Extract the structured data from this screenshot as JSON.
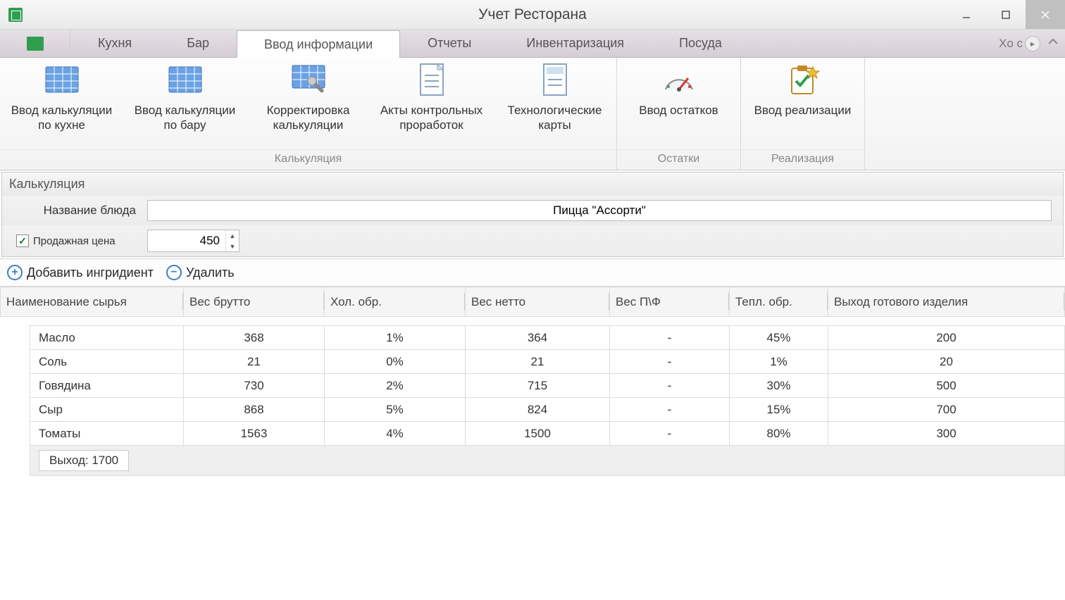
{
  "app": {
    "title": "Учет Ресторана"
  },
  "tabs": {
    "items": [
      "Кухня",
      "Бар",
      "Ввод информации",
      "Отчеты",
      "Инвентаризация",
      "Посуда"
    ],
    "active_index": 2,
    "overflow_hint": "Хо с"
  },
  "ribbon": {
    "groups": [
      {
        "label": "Калькуляция",
        "items": [
          {
            "name": "kitchen-calc",
            "label": "Ввод калькуляции\nпо кухне",
            "icon": "grid-icon"
          },
          {
            "name": "bar-calc",
            "label": "Ввод калькуляции\nпо бару",
            "icon": "grid-icon"
          },
          {
            "name": "correct-calc",
            "label": "Корректировка\nкалькуляции",
            "icon": "grid-wrench-icon"
          },
          {
            "name": "control-acts",
            "label": "Акты контрольных\nпроработок",
            "icon": "doc-text-icon"
          },
          {
            "name": "tech-cards",
            "label": "Технологические\nкарты",
            "icon": "doc-lines-icon"
          }
        ]
      },
      {
        "label": "Остатки",
        "items": [
          {
            "name": "stock-input",
            "label": "Ввод остатков",
            "icon": "gauge-icon"
          }
        ]
      },
      {
        "label": "Реализация",
        "items": [
          {
            "name": "sales-input",
            "label": "Ввод реализации",
            "icon": "clipboard-star-icon"
          }
        ]
      }
    ]
  },
  "panel": {
    "title": "Калькуляция",
    "dish_label": "Название блюда",
    "dish_value": "Пицца \"Ассорти\"",
    "price_label": "Продажная цена",
    "price_value": "450",
    "price_checked": true
  },
  "toolbar": {
    "add_label": "Добавить ингридиент",
    "del_label": "Удалить"
  },
  "table": {
    "columns": [
      "Наименование сырья",
      "Вес брутто",
      "Хол. обр.",
      "Вес нетто",
      "Вес П\\Ф",
      "Тепл. обр.",
      "Выход готового изделия"
    ],
    "rows": [
      {
        "name": "Масло",
        "gross": "368",
        "cold": "1%",
        "net": "364",
        "pf": "-",
        "heat": "45%",
        "out": "200"
      },
      {
        "name": "Соль",
        "gross": "21",
        "cold": "0%",
        "net": "21",
        "pf": "-",
        "heat": "1%",
        "out": "20"
      },
      {
        "name": "Говядина",
        "gross": "730",
        "cold": "2%",
        "net": "715",
        "pf": "-",
        "heat": "30%",
        "out": "500"
      },
      {
        "name": "Сыр",
        "gross": "868",
        "cold": "5%",
        "net": "824",
        "pf": "-",
        "heat": "15%",
        "out": "700"
      },
      {
        "name": "Томаты",
        "gross": "1563",
        "cold": "4%",
        "net": "1500",
        "pf": "-",
        "heat": "80%",
        "out": "300"
      }
    ],
    "total_label": "Выход: 1700"
  }
}
